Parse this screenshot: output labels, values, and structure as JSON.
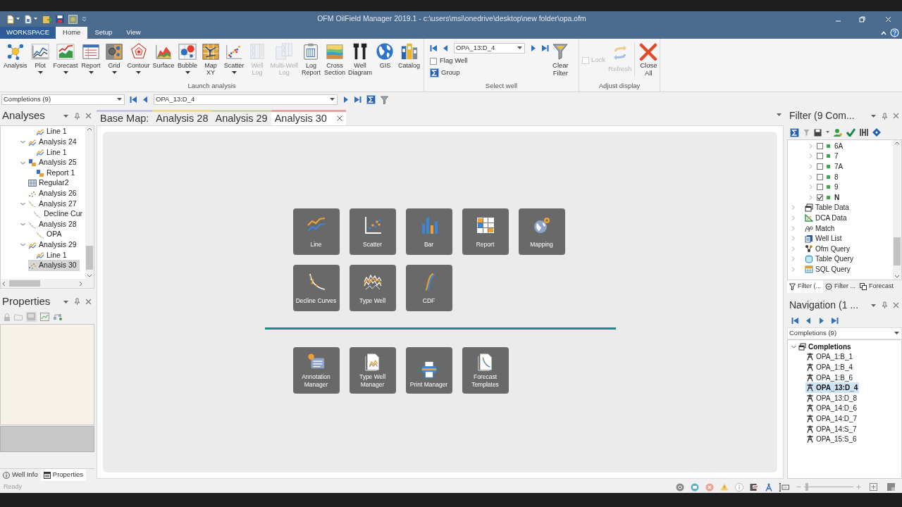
{
  "title_bar": {
    "title": "OFM OilField Manager 2019.1 - c:\\users\\msi\\onedrive\\desktop\\new folder\\opa.ofm"
  },
  "ribbon_tabs": [
    {
      "label": "WORKSPACE",
      "kind": "file",
      "selected": false
    },
    {
      "label": "Home",
      "kind": "tab",
      "selected": true
    },
    {
      "label": "Setup",
      "kind": "tab",
      "selected": false
    },
    {
      "label": "View",
      "kind": "tab",
      "selected": false
    }
  ],
  "launch_analysis": {
    "label": "Launch analysis",
    "buttons": [
      {
        "label": "Analysis",
        "dropdown": false,
        "disabled": false
      },
      {
        "label": "Plot",
        "dropdown": true,
        "disabled": false
      },
      {
        "label": "Forecast",
        "dropdown": true,
        "disabled": false
      },
      {
        "label": "Report",
        "dropdown": true,
        "disabled": false
      },
      {
        "label": "Grid",
        "dropdown": true,
        "disabled": false
      },
      {
        "label": "Contour",
        "dropdown": true,
        "disabled": false
      },
      {
        "label": "Surface",
        "dropdown": false,
        "disabled": false
      },
      {
        "label": "Bubble",
        "dropdown": true,
        "disabled": false
      },
      {
        "label": "Map\nXY",
        "dropdown": false,
        "disabled": false
      },
      {
        "label": "Scatter",
        "dropdown": true,
        "disabled": false
      },
      {
        "label": "Well\nLog",
        "dropdown": false,
        "disabled": true
      },
      {
        "label": "Multi-Well\nLog",
        "dropdown": false,
        "disabled": true
      },
      {
        "label": "Log\nReport",
        "dropdown": false,
        "disabled": false
      },
      {
        "label": "Cross\nSection",
        "dropdown": false,
        "disabled": false
      },
      {
        "label": "Well\nDiagram",
        "dropdown": false,
        "disabled": false
      },
      {
        "label": "GIS",
        "dropdown": false,
        "disabled": false
      },
      {
        "label": "Catalog",
        "dropdown": false,
        "disabled": false
      }
    ]
  },
  "select_well": {
    "label": "Select well",
    "well": "OPA_13:D_4",
    "flag_well": {
      "label": "Flag Well",
      "checked": false
    },
    "group": {
      "label": "Group"
    },
    "clear_filter": {
      "label": "Clear\nFilter"
    }
  },
  "adjust_display": {
    "label": "Adjust display",
    "lock": {
      "label": "Lock",
      "checked": false,
      "disabled": true
    },
    "refresh": {
      "label": "Refresh",
      "disabled": true
    },
    "close_all": {
      "label": "Close\nAll"
    }
  },
  "toolbar": {
    "category": "Completions (9)",
    "well": "OPA_13:D_4"
  },
  "analyses_panel": {
    "title": "Analyses",
    "continued_children": [
      {
        "label": "Line 1",
        "kind": "line",
        "selected": false
      }
    ],
    "items": [
      {
        "label": "Analysis 24",
        "kind": "line",
        "selected": false,
        "expanded": true,
        "children": [
          {
            "label": "Line 1",
            "kind": "line",
            "selected": false
          }
        ]
      },
      {
        "label": "Analysis 25",
        "kind": "report",
        "selected": false,
        "expanded": true,
        "children": [
          {
            "label": "Report 1",
            "kind": "report",
            "selected": false
          }
        ]
      },
      {
        "label": "Regular2",
        "kind": "map",
        "selected": false
      },
      {
        "label": "Analysis 26",
        "kind": "scatter",
        "selected": false
      },
      {
        "label": "Analysis 27",
        "kind": "decline",
        "selected": false,
        "expanded": true,
        "children": [
          {
            "label": "Decline Cur",
            "kind": "decline",
            "selected": false
          }
        ]
      },
      {
        "label": "Analysis 28",
        "kind": "decline",
        "selected": false,
        "expanded": true,
        "children": [
          {
            "label": "OPA",
            "kind": "decline",
            "selected": false
          }
        ]
      },
      {
        "label": "Analysis 29",
        "kind": "line",
        "selected": false,
        "expanded": true,
        "children": [
          {
            "label": "Line 1",
            "kind": "line",
            "selected": false
          }
        ]
      },
      {
        "label": "Analysis 30",
        "kind": "scatter",
        "selected": true
      }
    ]
  },
  "properties_panel": {
    "title": "Properties",
    "tabs": [
      {
        "label": "Well Info",
        "selected": false
      },
      {
        "label": "Properties",
        "selected": true
      }
    ]
  },
  "document_tabs": [
    {
      "label": "Base Map:",
      "color": "#c9c6e6",
      "selected": false
    },
    {
      "label": "Analysis 28",
      "color": "#efdc94",
      "selected": false
    },
    {
      "label": "Analysis 29",
      "color": "#cfd6b6",
      "selected": false
    },
    {
      "label": "Analysis 30",
      "color": "#e8a4a4",
      "selected": true
    }
  ],
  "analysis_tiles": [
    {
      "label": "Line"
    },
    {
      "label": "Scatter"
    },
    {
      "label": "Bar"
    },
    {
      "label": "Report"
    },
    {
      "label": "Mapping"
    },
    {
      "label": "Decline Curves"
    },
    {
      "label": "Type Well"
    },
    {
      "label": "CDF"
    }
  ],
  "manager_tiles": [
    {
      "label": "Annotation\nManager"
    },
    {
      "label": "Type Well\nManager"
    },
    {
      "label": "Print Manager"
    },
    {
      "label": "Forecast\nTemplates"
    }
  ],
  "filter_panel": {
    "title": "Filter (9 Com...",
    "items": [
      {
        "label": "6A",
        "kind": "value",
        "checked": false,
        "expanded": false
      },
      {
        "label": "7",
        "kind": "value",
        "checked": false,
        "expanded": false
      },
      {
        "label": "7A",
        "kind": "value",
        "checked": false,
        "expanded": false
      },
      {
        "label": "8",
        "kind": "value",
        "checked": false,
        "expanded": false
      },
      {
        "label": "9",
        "kind": "value",
        "checked": false,
        "expanded": false
      },
      {
        "label": "N",
        "kind": "value",
        "checked": true,
        "expanded": false
      },
      {
        "label": "Table Data",
        "kind": "table",
        "expanded": false
      },
      {
        "label": "DCA Data",
        "kind": "dca",
        "expanded": false
      },
      {
        "label": "Match",
        "kind": "match",
        "expanded": false
      },
      {
        "label": "Well List",
        "kind": "well_list",
        "expanded": false
      },
      {
        "label": "Ofm Query",
        "kind": "ofm_query",
        "expanded": false
      },
      {
        "label": "Table Query",
        "kind": "table_query",
        "expanded": false
      },
      {
        "label": "SQL Query",
        "kind": "sql_query",
        "expanded": false
      }
    ],
    "tabs": [
      {
        "label": "Filter (...",
        "selected": true
      },
      {
        "label": "Filter ...",
        "selected": false
      },
      {
        "label": "Forecast",
        "selected": false
      }
    ]
  },
  "navigation_panel": {
    "title": "Navigation (1 ...",
    "category": "Completions (9)",
    "tree": {
      "label": "Completions",
      "expanded": true,
      "children": [
        {
          "label": "OPA_1:B_1",
          "selected": false
        },
        {
          "label": "OPA_1:B_4",
          "selected": false
        },
        {
          "label": "OPA_1:B_6",
          "selected": false
        },
        {
          "label": "OPA_13:D_4",
          "selected": true
        },
        {
          "label": "OPA_13:D_8",
          "selected": false
        },
        {
          "label": "OPA_14:D_6",
          "selected": false
        },
        {
          "label": "OPA_14:D_7",
          "selected": false
        },
        {
          "label": "OPA_14:S_7",
          "selected": false
        },
        {
          "label": "OPA_15:S_6",
          "selected": false
        }
      ]
    }
  },
  "status_bar": {
    "status": "Ready",
    "zoom_slider": {
      "level": 0.05
    }
  }
}
